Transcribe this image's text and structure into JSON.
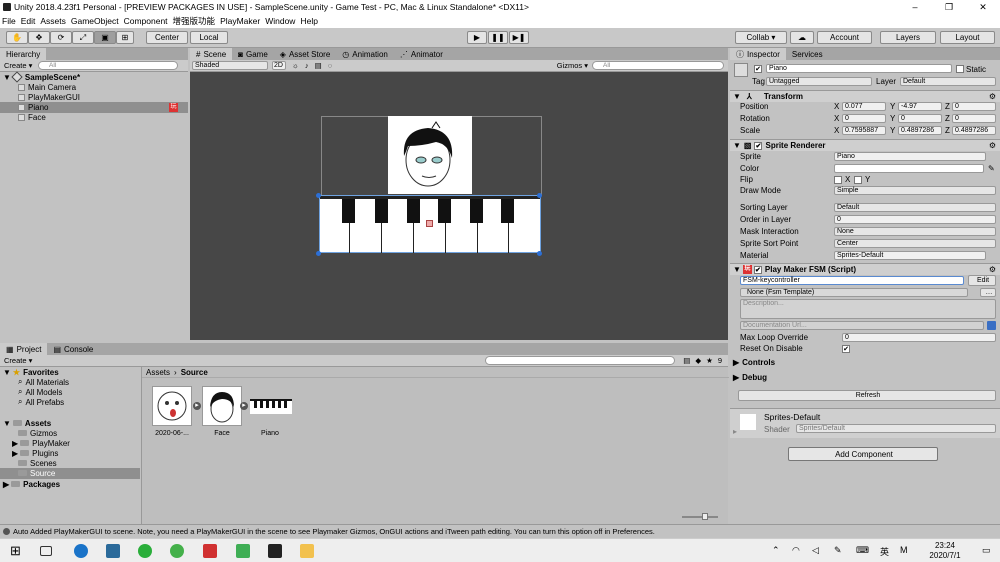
{
  "title": "Unity 2018.4.23f1 Personal - [PREVIEW PACKAGES IN USE] - SampleScene.unity - Game Test - PC, Mac & Linux Standalone* <DX11>",
  "window_controls": [
    "–",
    "❐",
    "✕"
  ],
  "menu": [
    "File",
    "Edit",
    "Assets",
    "GameObject",
    "Component",
    "增强版功能",
    "PlayMaker",
    "Window",
    "Help"
  ],
  "toolbar": {
    "center": "Center",
    "local": "Local",
    "collab": "Collab ▾",
    "account": "Account",
    "layers": "Layers",
    "layout": "Layout"
  },
  "hierarchy": {
    "tab": "Hierarchy",
    "create": "Create ▾",
    "search": "All",
    "scene": "SampleScene*",
    "items": [
      "Main Camera",
      "PlayMakerGUI",
      "Piano",
      "Face"
    ]
  },
  "scene_tabs": [
    "Scene",
    "Game",
    "Asset Store",
    "Animation",
    "Animator"
  ],
  "scene_bar": {
    "shading": "Shaded",
    "mode": "2D",
    "gizmos": "Gizmos ▾",
    "search": "All"
  },
  "project": {
    "tabs": [
      "Project",
      "Console"
    ],
    "create": "Create ▾",
    "favorites": "Favorites",
    "fav_items": [
      "All Materials",
      "All Models",
      "All Prefabs"
    ],
    "assets": "Assets",
    "asset_items": [
      "Gizmos",
      "PlayMaker",
      "Plugins",
      "Scenes",
      "Source"
    ],
    "packages": "Packages",
    "breadcrumb_root": "Assets",
    "breadcrumb_leaf": "Source",
    "files": [
      "2020-06-...",
      "Face",
      "Piano"
    ],
    "badge": "9"
  },
  "inspector": {
    "tabs": [
      "Inspector",
      "Services"
    ],
    "name": "Piano",
    "static": "Static",
    "tag_label": "Tag",
    "tag": "Untagged",
    "layer_label": "Layer",
    "layer": "Default",
    "transform": {
      "title": "Transform",
      "position_label": "Position",
      "rotation_label": "Rotation",
      "scale_label": "Scale",
      "position": [
        "0.077",
        "-4.97",
        "0"
      ],
      "rotation": [
        "0",
        "0",
        "0"
      ],
      "scale": [
        "0.7595887",
        "0.4897286",
        "0.4897286"
      ]
    },
    "sprite_renderer": {
      "title": "Sprite Renderer",
      "sprite_label": "Sprite",
      "sprite": "Piano",
      "color_label": "Color",
      "flip_label": "Flip",
      "flip_x": "X",
      "flip_y": "Y",
      "draw_mode_label": "Draw Mode",
      "draw_mode": "Simple",
      "sorting_layer_label": "Sorting Layer",
      "sorting_layer": "Default",
      "order_label": "Order in Layer",
      "order": "0",
      "mask_label": "Mask Interaction",
      "mask": "None",
      "sort_point_label": "Sprite Sort Point",
      "sort_point": "Center",
      "material_label": "Material",
      "material": "Sprites-Default"
    },
    "fsm": {
      "title": "Play Maker FSM (Script)",
      "name": "FSM-keycontroller",
      "edit": "Edit",
      "template": "None (Fsm Template)",
      "description": "Description...",
      "doc_url": "Documentation Url...",
      "max_loop_label": "Max Loop Override",
      "max_loop": "0",
      "reset_label": "Reset On Disable",
      "controls": "Controls",
      "debug": "Debug",
      "refresh": "Refresh"
    },
    "material": {
      "name": "Sprites-Default",
      "shader_label": "Shader",
      "shader": "Sprites/Default"
    },
    "add_component": "Add Component"
  },
  "status": "Auto Added PlayMakerGUI to scene. Note, you need a PlayMakerGUI in the scene to see Playmaker Gizmos, OnGUI actions and iTween path editing. You can turn this option off in Preferences.",
  "taskbar": {
    "time": "23:24",
    "date": "2020/7/1",
    "ime": "英",
    "lang": "M"
  }
}
